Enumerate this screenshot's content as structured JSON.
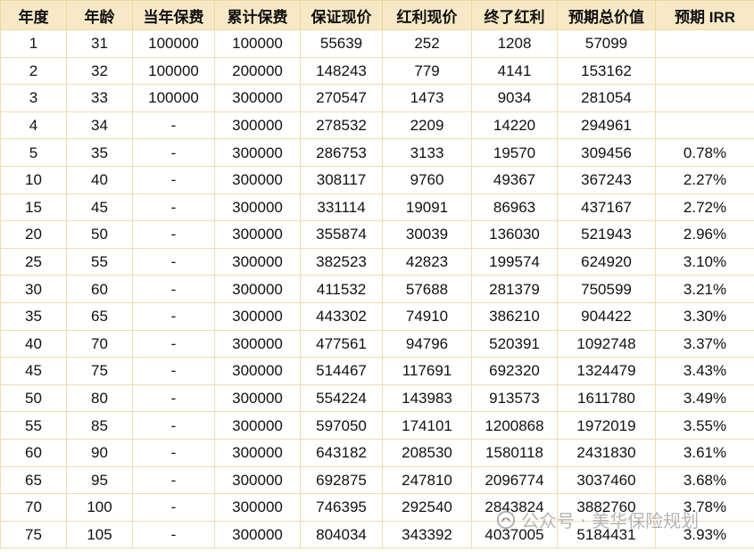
{
  "table": {
    "headers": [
      "年度",
      "年龄",
      "当年保费",
      "累计保费",
      "保证现价",
      "红利现价",
      "终了红利",
      "预期总价值",
      "预期 IRR"
    ],
    "rows": [
      [
        "1",
        "31",
        "100000",
        "100000",
        "55639",
        "252",
        "1208",
        "57099",
        ""
      ],
      [
        "2",
        "32",
        "100000",
        "200000",
        "148243",
        "779",
        "4141",
        "153162",
        ""
      ],
      [
        "3",
        "33",
        "100000",
        "300000",
        "270547",
        "1473",
        "9034",
        "281054",
        ""
      ],
      [
        "4",
        "34",
        "-",
        "300000",
        "278532",
        "2209",
        "14220",
        "294961",
        ""
      ],
      [
        "5",
        "35",
        "-",
        "300000",
        "286753",
        "3133",
        "19570",
        "309456",
        "0.78%"
      ],
      [
        "10",
        "40",
        "-",
        "300000",
        "308117",
        "9760",
        "49367",
        "367243",
        "2.27%"
      ],
      [
        "15",
        "45",
        "-",
        "300000",
        "331114",
        "19091",
        "86963",
        "437167",
        "2.72%"
      ],
      [
        "20",
        "50",
        "-",
        "300000",
        "355874",
        "30039",
        "136030",
        "521943",
        "2.96%"
      ],
      [
        "25",
        "55",
        "-",
        "300000",
        "382523",
        "42823",
        "199574",
        "624920",
        "3.10%"
      ],
      [
        "30",
        "60",
        "-",
        "300000",
        "411532",
        "57688",
        "281379",
        "750599",
        "3.21%"
      ],
      [
        "35",
        "65",
        "-",
        "300000",
        "443302",
        "74910",
        "386210",
        "904422",
        "3.30%"
      ],
      [
        "40",
        "70",
        "-",
        "300000",
        "477561",
        "94796",
        "520391",
        "1092748",
        "3.37%"
      ],
      [
        "45",
        "75",
        "-",
        "300000",
        "514467",
        "117691",
        "692320",
        "1324479",
        "3.43%"
      ],
      [
        "50",
        "80",
        "-",
        "300000",
        "554224",
        "143983",
        "913573",
        "1611780",
        "3.49%"
      ],
      [
        "55",
        "85",
        "-",
        "300000",
        "597050",
        "174101",
        "1200868",
        "1972019",
        "3.55%"
      ],
      [
        "60",
        "90",
        "-",
        "300000",
        "643182",
        "208530",
        "1580118",
        "2431830",
        "3.61%"
      ],
      [
        "65",
        "95",
        "-",
        "300000",
        "692875",
        "247810",
        "2096774",
        "3037460",
        "3.68%"
      ],
      [
        "70",
        "100",
        "-",
        "300000",
        "746395",
        "292540",
        "2843824",
        "3882760",
        "3.78%"
      ],
      [
        "75",
        "105",
        "-",
        "300000",
        "804034",
        "343392",
        "4037005",
        "5184431",
        "3.93%"
      ]
    ]
  },
  "watermark": {
    "text": "公众号 · 美华保险规划",
    "icon": "wechat-official-account-icon"
  },
  "colors": {
    "header_bg": "#f7e9c6",
    "border": "#f0dcae"
  }
}
